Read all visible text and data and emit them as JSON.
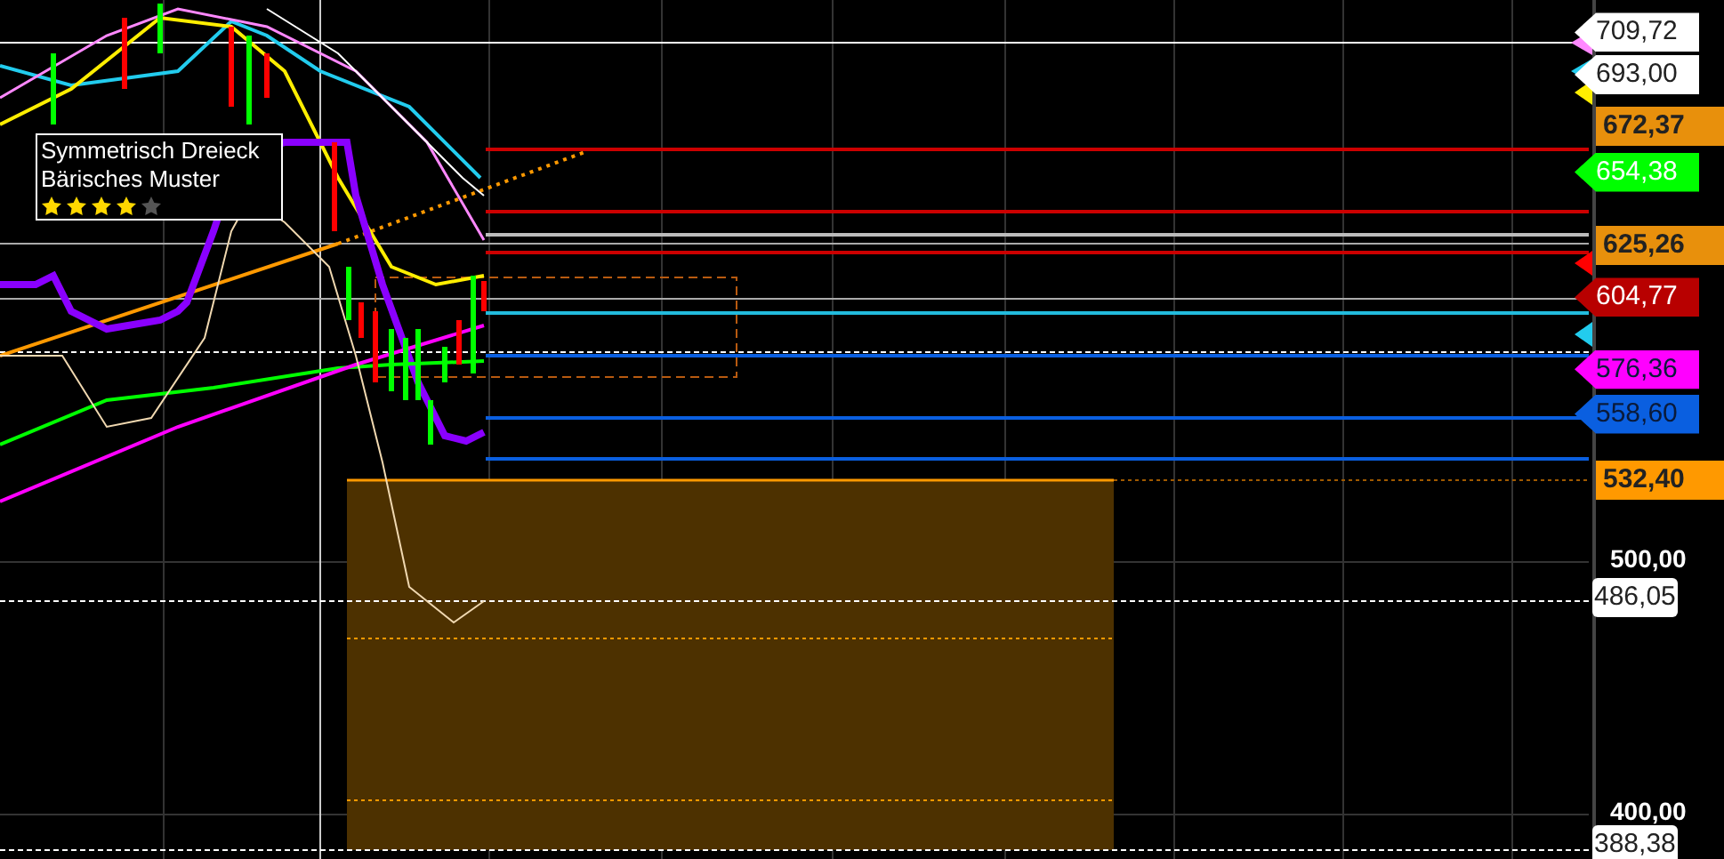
{
  "pattern_box": {
    "lines": [
      "Symmetrisch Dreieck",
      "Bärisches Muster"
    ],
    "stars": 4
  },
  "price_labels": [
    {
      "text": "709,72",
      "kind": "flag",
      "color": "#ffffff"
    },
    {
      "text": "693,00",
      "kind": "flag",
      "color": "#ffffff"
    },
    {
      "text": "672,37",
      "kind": "box",
      "color": "#e8900c"
    },
    {
      "text": "654,38",
      "kind": "flag",
      "color": "#00ff00"
    },
    {
      "text": "625,26",
      "kind": "box",
      "color": "#e8900c"
    },
    {
      "text": "604,77",
      "kind": "flag",
      "color": "#b80000"
    },
    {
      "text": "576,36",
      "kind": "flag",
      "color": "#ff00ff"
    },
    {
      "text": "558,60",
      "kind": "flag",
      "color": "#0a5fe0"
    },
    {
      "text": "532,40",
      "kind": "box",
      "color": "#ff9900"
    },
    {
      "text": "486,05",
      "kind": "tag",
      "color": "#ffffff"
    },
    {
      "text": "388,38",
      "kind": "tag",
      "color": "#ffffff"
    }
  ],
  "axis_ticks": [
    "500,00",
    "400,00"
  ]
}
